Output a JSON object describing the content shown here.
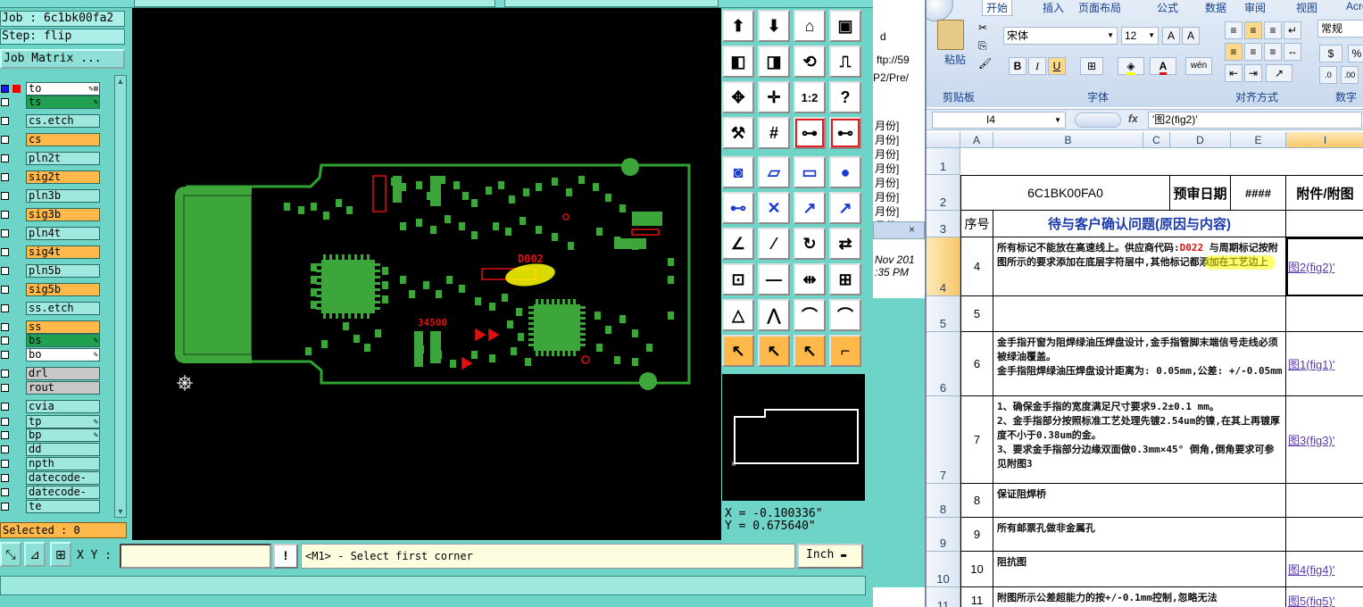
{
  "cam": {
    "job_label": "Job : 6c1bk00fa2",
    "step_label": "Step: flip",
    "job_matrix_button": "Job Matrix ...",
    "layers": [
      {
        "name": "to",
        "style": "white",
        "pen": "✎⊞",
        "box": "mark"
      },
      {
        "name": "ts",
        "style": "green",
        "pen": "✎",
        "box": "plain"
      },
      {
        "name": "cs.etch",
        "style": "cyan",
        "pen": "",
        "box": "plain"
      },
      {
        "name": "cs",
        "style": "orange",
        "pen": "",
        "box": "plain"
      },
      {
        "name": "pln2t",
        "style": "cyan",
        "pen": "",
        "box": "plain"
      },
      {
        "name": "sig2t",
        "style": "orange",
        "pen": "",
        "box": "plain"
      },
      {
        "name": "pln3b",
        "style": "cyan",
        "pen": "",
        "box": "plain"
      },
      {
        "name": "sig3b",
        "style": "orange",
        "pen": "",
        "box": "plain"
      },
      {
        "name": "pln4t",
        "style": "cyan",
        "pen": "",
        "box": "plain"
      },
      {
        "name": "sig4t",
        "style": "orange",
        "pen": "",
        "box": "plain"
      },
      {
        "name": "pln5b",
        "style": "cyan",
        "pen": "",
        "box": "plain"
      },
      {
        "name": "sig5b",
        "style": "orange",
        "pen": "",
        "box": "plain"
      },
      {
        "name": "ss.etch",
        "style": "cyan",
        "pen": "",
        "box": "plain"
      },
      {
        "name": "ss",
        "style": "orange",
        "pen": "",
        "box": "plain"
      },
      {
        "name": "bs",
        "style": "green",
        "pen": "✎",
        "box": "plain"
      },
      {
        "name": "bo",
        "style": "white",
        "pen": "✎",
        "box": "plain"
      },
      {
        "name": "drl",
        "style": "gray",
        "pen": "",
        "box": "plain"
      },
      {
        "name": "rout",
        "style": "gray",
        "pen": "",
        "box": "plain"
      },
      {
        "name": "cvia",
        "style": "cyan",
        "pen": "",
        "box": "plain"
      },
      {
        "name": "tp",
        "style": "cyan",
        "pen": "✎",
        "box": "plain"
      },
      {
        "name": "bp",
        "style": "cyan",
        "pen": "✎",
        "box": "plain"
      },
      {
        "name": "dd",
        "style": "cyan",
        "pen": "",
        "box": "plain"
      },
      {
        "name": "npth",
        "style": "cyan",
        "pen": "",
        "box": "plain"
      },
      {
        "name": "datecode-pto",
        "style": "cyan",
        "pen": "",
        "box": "plain"
      },
      {
        "name": "datecode-pbo",
        "style": "cyan",
        "pen": "",
        "box": "plain"
      },
      {
        "name": "te",
        "style": "cyan",
        "pen": "",
        "box": "plain"
      }
    ],
    "selected_label": "Selected : 0",
    "board_text_1": "D002",
    "board_text_2": "34500",
    "coords": {
      "x": "X = -0.100336\"",
      "y": "Y = 0.675640\""
    },
    "xy_label": "X Y :",
    "xy_value": "",
    "message": "<M1> - Select first corner",
    "unit_button": "Inch",
    "warn_button": "!",
    "toolbar_icons": [
      "single-layer-icon",
      "feature-down-icon",
      "home-icon",
      "snap-window-icon",
      "pan-left-icon",
      "pan-right-icon",
      "redraw-icon",
      "zoom-icon",
      "zoom-fit-icon",
      "zoom-center-icon",
      "1:2",
      "help-icon",
      "pliers-icon",
      "grid-icon",
      "measure-net-icon",
      "measure-net-alt-icon",
      "pad-select-icon",
      "polygon-icon",
      "ruler-icon",
      "circle-icon",
      "line-connect-icon",
      "cross-icon",
      "connect-point-icon",
      "connect-point-alt-icon",
      "angle-icon",
      "line-arc-icon",
      "rotate-icon",
      "mirror-icon",
      "pad-corner-icon",
      "trace-icon",
      "measure-gap-icon",
      "copper-feature-icon",
      "triangle-measure-icon",
      "triangle-alt-icon",
      "arch-icon",
      "arch-alt-icon",
      "pointer-icon",
      "pointer-select-icon",
      "pointer-circle-icon",
      "pointer-node-icon"
    ]
  },
  "middle_window": {
    "lines": [
      "d",
      "ftp://59",
      "P2/Pre/",
      "月份]",
      "月份]",
      "月份]",
      "月份]",
      "月份]",
      "月份]",
      "月份]",
      "月份]",
      "Nov 201",
      ":35 PM"
    ]
  },
  "excel": {
    "tabs": [
      "开始",
      "插入",
      "页面布局",
      "公式",
      "数据",
      "审阅",
      "视图",
      "Acrob"
    ],
    "paste_label": "粘贴",
    "font_name": "宋体",
    "font_size": "12",
    "number_format": "常规",
    "groups": [
      "剪贴板",
      "字体",
      "对齐方式",
      "数字"
    ],
    "name_box": "I4",
    "formula": "'图2(fig2)'",
    "columns": [
      "A",
      "B",
      "C",
      "D",
      "E",
      "I"
    ],
    "header_part": "6C1BK00FA0",
    "header_date_label": "预审日期",
    "header_date_value": "####",
    "header_attach": "附件/附图",
    "col_seq": "序号",
    "col_issue": "待与客户确认问题(原因与内容)",
    "rows": [
      {
        "row": "4",
        "num": "4",
        "text_a": "所有标记不能放在高速线上。供应商代码:",
        "code": "D022",
        "text_b": " 与周期标记按附图所示的要求添加在底层字符层中,其他标记都添加在工艺边上",
        "link": "图2(fig2)'"
      },
      {
        "row": "5",
        "num": "5",
        "text": "",
        "link": ""
      },
      {
        "row": "6",
        "num": "6",
        "text": "金手指开窗为阻焊绿油压焊盘设计,金手指管脚末端信号走线必须被绿油覆盖。\n金手指阻焊绿油压焊盘设计距离为: 0.05mm,公差: +/-0.05mm",
        "link": "图1(fig1)'"
      },
      {
        "row": "7",
        "num": "7",
        "text": "1、确保金手指的宽度满足尺寸要求9.2±0.1 mm。\n2、金手指部分按照标准工艺处理先镀2.54um的镍,在其上再镀厚度不小于0.38um的金。\n3、要求金手指部分边缘双面做0.3mm×45° 倒角,倒角要求可参见附图3",
        "link": "图3(fig3)'"
      },
      {
        "row": "8",
        "num": "8",
        "text": "保证阻焊桥",
        "link": ""
      },
      {
        "row": "9",
        "num": "9",
        "text": "所有邮票孔做非金属孔",
        "link": ""
      },
      {
        "row": "10",
        "num": "10",
        "text": "阻抗图",
        "link": "图4(fig4)'"
      },
      {
        "row": "11",
        "num": "11",
        "text": "附图所示公差超能力的按+/-0.1mm控制,忽略无法",
        "link": "图5(fig5)'"
      }
    ],
    "row_heads": [
      "1",
      "2",
      "3"
    ]
  }
}
